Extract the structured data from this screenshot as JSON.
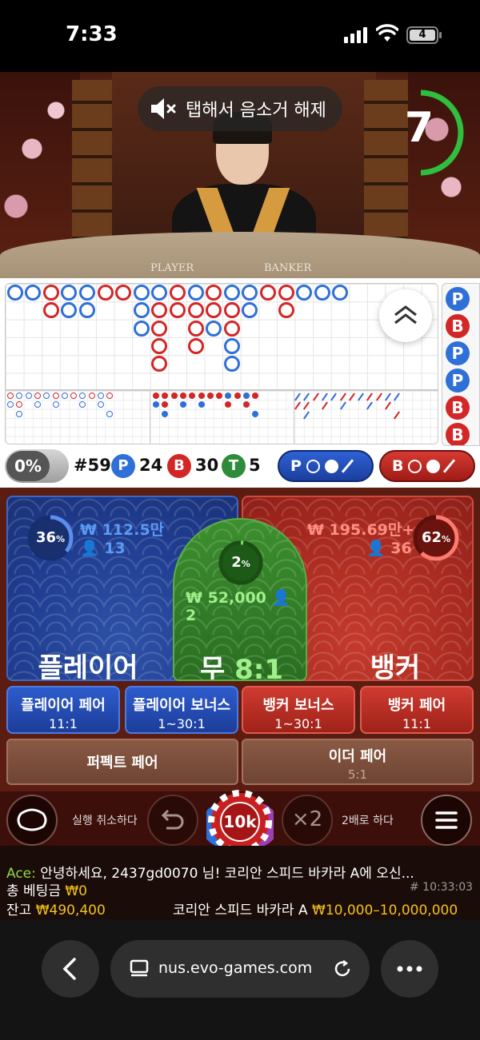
{
  "status_bar": {
    "time": "7:33",
    "battery_level": "4"
  },
  "video": {
    "mute_notice": "탭해서 음소거 해제",
    "countdown": "7",
    "table_labels": {
      "player": "PLAYER",
      "banker": "BANKER"
    }
  },
  "stats": {
    "percent_toggle": "0%",
    "round": "#59",
    "player_letter": "P",
    "player_count": "24",
    "banker_letter": "B",
    "banker_count": "30",
    "tie_letter": "T",
    "tie_count": "5",
    "player_ask_letter": "P",
    "banker_ask_letter": "B"
  },
  "prediction_column": [
    "P",
    "B",
    "P",
    "P",
    "B",
    "B"
  ],
  "betting": {
    "player": {
      "percent": "36",
      "pct_sign": "%",
      "amount": "₩ 112.5만",
      "players": "13",
      "label": "플레이어"
    },
    "banker": {
      "percent": "62",
      "pct_sign": "%",
      "amount": "₩ 195.69만+",
      "players": "36",
      "label": "뱅커"
    },
    "tie": {
      "percent": "2",
      "pct_sign": "%",
      "amount": "₩ 52,000",
      "players": "2",
      "label": "무",
      "odds": "8:1"
    },
    "side_bets": [
      {
        "label": "플레이어 페어",
        "odds": "11:1"
      },
      {
        "label": "플레이어 보너스",
        "odds": "1~30:1"
      },
      {
        "label": "뱅커 보너스",
        "odds": "1~30:1"
      },
      {
        "label": "뱅커 페어",
        "odds": "11:1"
      }
    ],
    "perfect_pair": {
      "label": "퍼펙트 페어"
    },
    "either_pair": {
      "label": "이더 페어",
      "odds": "5:1"
    }
  },
  "controls": {
    "undo_label": "실행 취소하다",
    "chip_value": "10k",
    "double_symbol": "×2",
    "double_label": "2배로 하다"
  },
  "info": {
    "chat_user": "Ace:",
    "chat_message": " 안녕하세요, 2437gd0070 님! 코리안 스피드 바카라 A에 오신...",
    "total_bet_label": "총 베팅금",
    "total_bet_value": "₩0",
    "round_id": "# 10:33:03",
    "balance_label": "잔고",
    "balance_value": "₩490,400",
    "table_name": "코리안 스피드 바카라 A",
    "limits": "₩10,000–10,000,000"
  },
  "browser": {
    "url": "nus.evo-games.com"
  },
  "colors": {
    "player": "#2f6fd8",
    "banker": "#d32626",
    "tie": "#2e8b3a",
    "gold": "#f2c21a"
  }
}
